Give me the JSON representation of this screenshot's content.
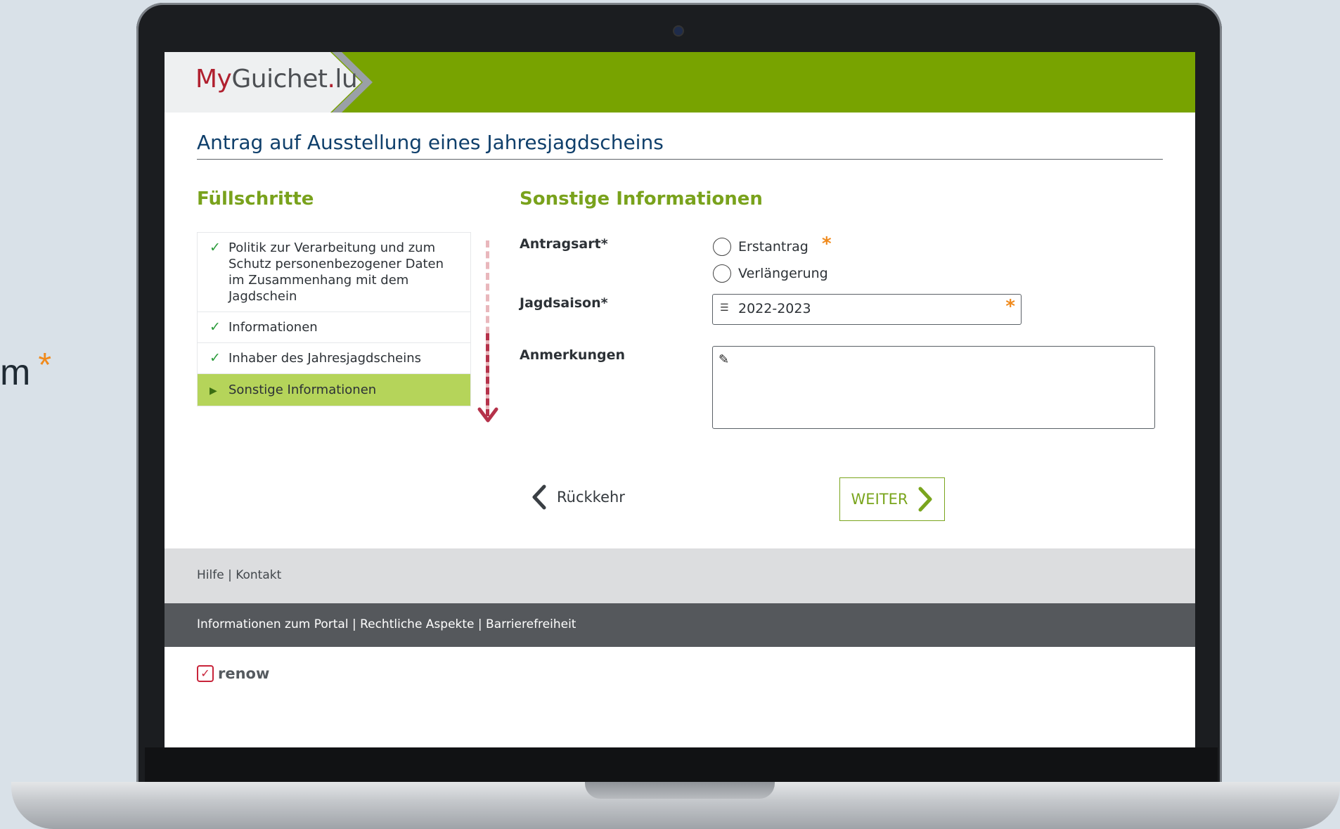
{
  "background": {
    "fragment_text": "m",
    "fragment_star": "*"
  },
  "header": {
    "logo_my": "My",
    "logo_guichet": "Guichet",
    "logo_dot": ".",
    "logo_lu": "lu"
  },
  "page": {
    "title": "Antrag auf Ausstellung eines Jahresjagdscheins"
  },
  "steps": {
    "heading": "Füllschritte",
    "items": [
      {
        "label": "Politik zur Verarbeitung und zum Schutz personenbezogener Daten im Zusammenhang mit dem Jagdschein",
        "status": "done",
        "mark": "✓"
      },
      {
        "label": "Informationen",
        "status": "done",
        "mark": "✓"
      },
      {
        "label": "Inhaber des Jahresjagdscheins",
        "status": "done",
        "mark": "✓"
      },
      {
        "label": "Sonstige Informationen",
        "status": "current",
        "mark": "▶"
      }
    ]
  },
  "form": {
    "heading": "Sonstige Informationen",
    "antragsart": {
      "label": "Antragsart*",
      "options": [
        "Erstantrag",
        "Verlängerung"
      ],
      "required_mark": "*"
    },
    "jagdsaison": {
      "label": "Jagdsaison*",
      "value": "2022-2023",
      "required_mark": "*",
      "icon": "list-icon"
    },
    "anmerkungen": {
      "label": "Anmerkungen",
      "value": "",
      "icon": "pencil-icon"
    }
  },
  "nav": {
    "back_label": "Rückkehr",
    "next_label": "WEITER"
  },
  "footer": {
    "top_links": "Hilfe | Kontakt",
    "bottom_links": "Informationen zum Portal | Rechtliche Aspekte | Barrierefreiheit",
    "brand": "renow"
  },
  "colors": {
    "brand_green": "#78a300",
    "accent_green": "#79a21c",
    "active_step": "#b5d45a",
    "title_blue": "#0f3f6b",
    "required_orange": "#f08a1c",
    "progress_red": "#b5324a"
  }
}
